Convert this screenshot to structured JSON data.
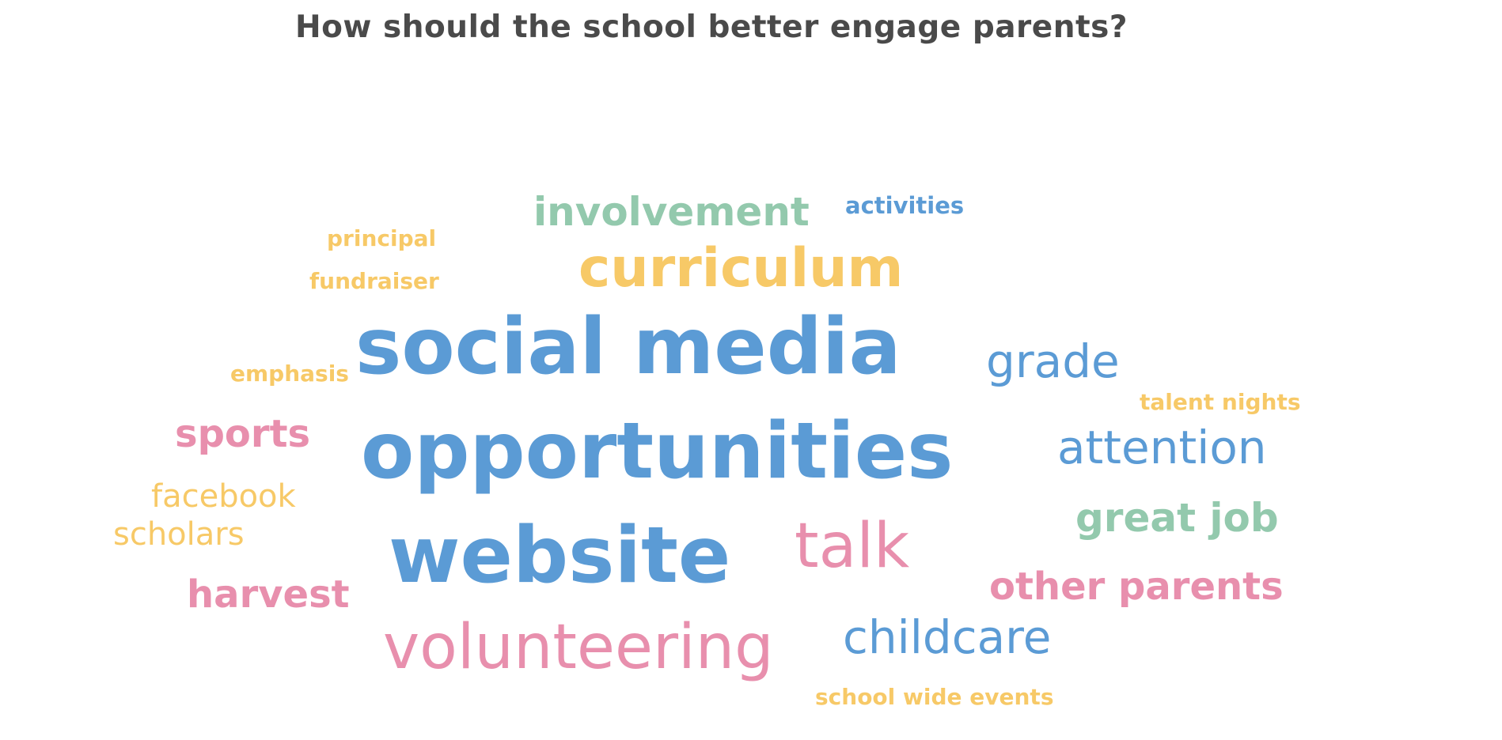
{
  "question": "How should the school better engage parents?",
  "colors": {
    "title": "#4a4a4a",
    "blue": "#5b9bd5",
    "green": "#93c9ad",
    "yellow": "#f7c967",
    "pink": "#e88fad"
  },
  "words": {
    "involvement": "involvement",
    "activities": "activities",
    "principal": "principal",
    "curriculum": "curriculum",
    "fundraiser": "fundraiser",
    "social_media": "social media",
    "grade": "grade",
    "emphasis": "emphasis",
    "talent_nights": "talent nights",
    "sports": "sports",
    "opportunities": "opportunities",
    "attention": "attention",
    "facebook": "facebook",
    "great_job": "great job",
    "scholars": "scholars",
    "website": "website",
    "talk": "talk",
    "harvest": "harvest",
    "other_parents": "other parents",
    "volunteering": "volunteering",
    "childcare": "childcare",
    "school_wide_events": "school wide events"
  }
}
